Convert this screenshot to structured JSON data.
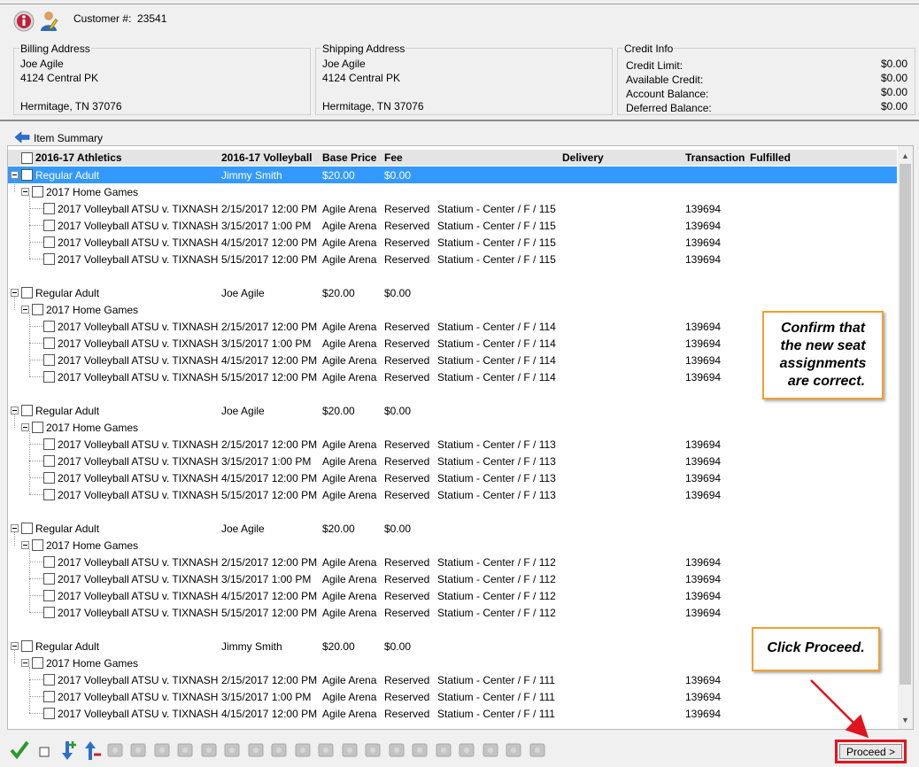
{
  "customer": {
    "label": "Customer #:",
    "number": "23541"
  },
  "billing": {
    "title": "Billing Address",
    "lines": [
      "Joe Agile",
      "4124 Central PK",
      "",
      "Hermitage, TN 37076"
    ]
  },
  "shipping": {
    "title": "Shipping Address",
    "lines": [
      "Joe Agile",
      "4124 Central PK",
      "",
      "Hermitage, TN 37076"
    ]
  },
  "credit": {
    "title": "Credit Info",
    "rows": [
      {
        "label": "Credit Limit:",
        "value": "$0.00"
      },
      {
        "label": "Available Credit:",
        "value": "$0.00"
      },
      {
        "label": "Account Balance:",
        "value": "$0.00"
      },
      {
        "label": "Deferred Balance:",
        "value": "$0.00"
      }
    ]
  },
  "summary": {
    "label": "Item Summary"
  },
  "columns": {
    "season": "2016-17 Athletics",
    "item": "2016-17 Volleyball",
    "base_price": "Base Price",
    "fee": "Fee",
    "delivery": "Delivery",
    "transaction": "Transaction",
    "fulfilled": "Fulfilled"
  },
  "groups": [
    {
      "price_type": "Regular Adult",
      "patron": "Jimmy  Smith",
      "price": "$20.00",
      "fee": "$0.00",
      "subgroup": "2017 Home Games",
      "selected": true,
      "events": [
        {
          "event": "2017 Volleyball ATSU v. TIXNASH",
          "date": "2/15/2017 12:00 PM",
          "venue": "Agile Arena",
          "status": "Reserved",
          "seat": "Statium  - Center / F / 115",
          "txn": "139694"
        },
        {
          "event": "2017 Volleyball ATSU v. TIXNASH",
          "date": "3/15/2017 1:00 PM",
          "venue": "Agile Arena",
          "status": "Reserved",
          "seat": "Statium  - Center / F / 115",
          "txn": "139694"
        },
        {
          "event": "2017 Volleyball ATSU v. TIXNASH",
          "date": "4/15/2017 12:00 PM",
          "venue": "Agile Arena",
          "status": "Reserved",
          "seat": "Statium  - Center / F / 115",
          "txn": "139694"
        },
        {
          "event": "2017 Volleyball ATSU v. TIXNASH",
          "date": "5/15/2017 12:00 PM",
          "venue": "Agile Arena",
          "status": "Reserved",
          "seat": "Statium  - Center / F / 115",
          "txn": "139694"
        }
      ]
    },
    {
      "price_type": "Regular Adult",
      "patron": "Joe Agile",
      "price": "$20.00",
      "fee": "$0.00",
      "subgroup": "2017 Home Games",
      "selected": false,
      "events": [
        {
          "event": "2017 Volleyball ATSU v. TIXNASH",
          "date": "2/15/2017 12:00 PM",
          "venue": "Agile Arena",
          "status": "Reserved",
          "seat": "Statium  - Center / F / 114",
          "txn": "139694"
        },
        {
          "event": "2017 Volleyball ATSU v. TIXNASH",
          "date": "3/15/2017 1:00 PM",
          "venue": "Agile Arena",
          "status": "Reserved",
          "seat": "Statium  - Center / F / 114",
          "txn": "139694"
        },
        {
          "event": "2017 Volleyball ATSU v. TIXNASH",
          "date": "4/15/2017 12:00 PM",
          "venue": "Agile Arena",
          "status": "Reserved",
          "seat": "Statium  - Center / F / 114",
          "txn": "139694"
        },
        {
          "event": "2017 Volleyball ATSU v. TIXNASH",
          "date": "5/15/2017 12:00 PM",
          "venue": "Agile Arena",
          "status": "Reserved",
          "seat": "Statium  - Center / F / 114",
          "txn": "139694"
        }
      ]
    },
    {
      "price_type": "Regular Adult",
      "patron": "Joe Agile",
      "price": "$20.00",
      "fee": "$0.00",
      "subgroup": "2017 Home Games",
      "selected": false,
      "events": [
        {
          "event": "2017 Volleyball ATSU v. TIXNASH",
          "date": "2/15/2017 12:00 PM",
          "venue": "Agile Arena",
          "status": "Reserved",
          "seat": "Statium  - Center / F / 113",
          "txn": "139694"
        },
        {
          "event": "2017 Volleyball ATSU v. TIXNASH",
          "date": "3/15/2017 1:00 PM",
          "venue": "Agile Arena",
          "status": "Reserved",
          "seat": "Statium  - Center / F / 113",
          "txn": "139694"
        },
        {
          "event": "2017 Volleyball ATSU v. TIXNASH",
          "date": "4/15/2017 12:00 PM",
          "venue": "Agile Arena",
          "status": "Reserved",
          "seat": "Statium  - Center / F / 113",
          "txn": "139694"
        },
        {
          "event": "2017 Volleyball ATSU v. TIXNASH",
          "date": "5/15/2017 12:00 PM",
          "venue": "Agile Arena",
          "status": "Reserved",
          "seat": "Statium  - Center / F / 113",
          "txn": "139694"
        }
      ]
    },
    {
      "price_type": "Regular Adult",
      "patron": "Joe Agile",
      "price": "$20.00",
      "fee": "$0.00",
      "subgroup": "2017 Home Games",
      "selected": false,
      "events": [
        {
          "event": "2017 Volleyball ATSU v. TIXNASH",
          "date": "2/15/2017 12:00 PM",
          "venue": "Agile Arena",
          "status": "Reserved",
          "seat": "Statium  - Center / F / 112",
          "txn": "139694"
        },
        {
          "event": "2017 Volleyball ATSU v. TIXNASH",
          "date": "3/15/2017 1:00 PM",
          "venue": "Agile Arena",
          "status": "Reserved",
          "seat": "Statium  - Center / F / 112",
          "txn": "139694"
        },
        {
          "event": "2017 Volleyball ATSU v. TIXNASH",
          "date": "4/15/2017 12:00 PM",
          "venue": "Agile Arena",
          "status": "Reserved",
          "seat": "Statium  - Center / F / 112",
          "txn": "139694"
        },
        {
          "event": "2017 Volleyball ATSU v. TIXNASH",
          "date": "5/15/2017 12:00 PM",
          "venue": "Agile Arena",
          "status": "Reserved",
          "seat": "Statium  - Center / F / 112",
          "txn": "139694"
        }
      ]
    },
    {
      "price_type": "Regular Adult",
      "patron": "Jimmy  Smith",
      "price": "$20.00",
      "fee": "$0.00",
      "subgroup": "2017 Home Games",
      "selected": false,
      "events": [
        {
          "event": "2017 Volleyball ATSU v. TIXNASH",
          "date": "2/15/2017 12:00 PM",
          "venue": "Agile Arena",
          "status": "Reserved",
          "seat": "Statium  - Center / F / 111",
          "txn": "139694"
        },
        {
          "event": "2017 Volleyball ATSU v. TIXNASH",
          "date": "3/15/2017 1:00 PM",
          "venue": "Agile Arena",
          "status": "Reserved",
          "seat": "Statium  - Center / F / 111",
          "txn": "139694"
        },
        {
          "event": "2017 Volleyball ATSU v. TIXNASH",
          "date": "4/15/2017 12:00 PM",
          "venue": "Agile Arena",
          "status": "Reserved",
          "seat": "Statium  - Center / F / 111",
          "txn": "139694"
        }
      ]
    }
  ],
  "callouts": {
    "confirm": [
      "Confirm that",
      "the new seat",
      "assignments",
      "are correct."
    ],
    "proceed": "Click Proceed."
  },
  "toolbar": {
    "icons": [
      "check-icon",
      "checkbox-icon",
      "move-down-add-icon",
      "move-up-remove-icon",
      "envelope-icon",
      "info-doc-icon",
      "printer-icon",
      "delete-icon",
      "dollar-icon",
      "coins-icon",
      "ticket-icon",
      "transfer-icon",
      "exchange-icon",
      "barcode-icon",
      "mail-icon",
      "scroll-icon",
      "users-icon",
      "user-edit-icon",
      "ticket-tag-icon",
      "ticket-remove-icon",
      "ticket-lock-icon",
      "ticket-check-icon",
      "help-icon"
    ],
    "proceed_label": "Proceed >"
  },
  "colors": {
    "selected_row": "#3399ff",
    "callout_border": "#f0a030",
    "highlight_red": "#e0141e"
  }
}
